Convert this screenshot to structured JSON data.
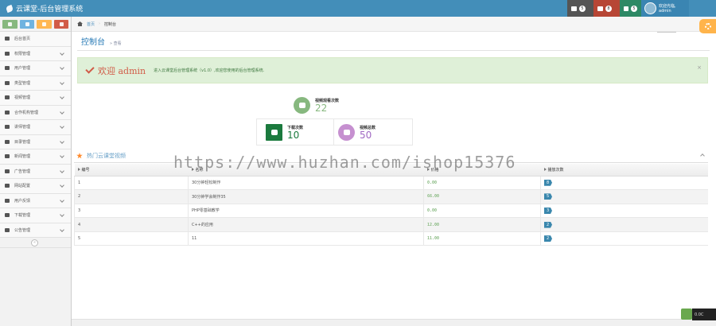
{
  "app": {
    "title": "云课堂-后台管理系统"
  },
  "navbar": {
    "tasks_count": "5",
    "notifications_count": "8",
    "messages_count": "5",
    "user_welcome": "欢迎光临,",
    "user_name": "admin",
    "avatar_text": "Z-01"
  },
  "sidebar": {
    "items": [
      {
        "label": "后台首页",
        "icon": "dashboard-icon",
        "arrow": false
      },
      {
        "label": "权限管理",
        "icon": "lock-icon",
        "arrow": true
      },
      {
        "label": "用户管理",
        "icon": "users-icon",
        "arrow": true
      },
      {
        "label": "类型管理",
        "icon": "list-icon",
        "arrow": true
      },
      {
        "label": "视频管理",
        "icon": "music-icon",
        "arrow": true
      },
      {
        "label": "合作机构管理",
        "icon": "edit-icon",
        "arrow": true
      },
      {
        "label": "讲师管理",
        "icon": "user-icon",
        "arrow": true
      },
      {
        "label": "目录管理",
        "icon": "folder-icon",
        "arrow": true
      },
      {
        "label": "新闻管理",
        "icon": "calendar-icon",
        "arrow": true
      },
      {
        "label": "广告管理",
        "icon": "bullhorn-icon",
        "arrow": true
      },
      {
        "label": "网站配置",
        "icon": "cogs-icon",
        "arrow": true
      },
      {
        "label": "用户反馈",
        "icon": "comments-icon",
        "arrow": true
      },
      {
        "label": "下载管理",
        "icon": "download-icon",
        "arrow": true
      },
      {
        "label": "公告管理",
        "icon": "credit-card-icon",
        "arrow": true
      }
    ],
    "collapse_symbol": "«"
  },
  "breadcrumb": {
    "home": "首页",
    "current": "控制台"
  },
  "page_header": {
    "title": "控制台",
    "subtitle": "» 查看"
  },
  "alert": {
    "welcome": "欢迎 admin",
    "text": "进入云课堂后台管理系统（v1.0）,欢迎您使用的后台管理系统.",
    "close": "×"
  },
  "stats": [
    {
      "label": "视频观看次数",
      "value": "22",
      "color": "#87b87f",
      "icon": "comments-icon"
    },
    {
      "label": "下载次数",
      "value": "10",
      "color": "#1b7a3e",
      "icon": "download-icon"
    },
    {
      "label": "视频总数",
      "value": "50",
      "color": "#a069c3",
      "icon": "video-camera-icon"
    }
  ],
  "hot_videos": {
    "title": "热门云课堂视频",
    "columns": [
      "编号",
      "名称",
      "价格",
      "播放次数"
    ],
    "rows": [
      {
        "id": "1",
        "name": "30分钟轻松制作",
        "price": "0.00",
        "plays": "8"
      },
      {
        "id": "2",
        "name": "30分钟学会制作35",
        "price": "66.00",
        "plays": "5"
      },
      {
        "id": "3",
        "name": "PHP零基础教学",
        "price": "0.00",
        "plays": "3"
      },
      {
        "id": "4",
        "name": "C++的应用",
        "price": "12.00",
        "plays": "2"
      },
      {
        "id": "5",
        "name": "11",
        "price": "11.00",
        "plays": "2"
      }
    ]
  },
  "watermark": "https://www.huzhan.com/ishop15376",
  "float_widget": {
    "text": "0.0C"
  }
}
